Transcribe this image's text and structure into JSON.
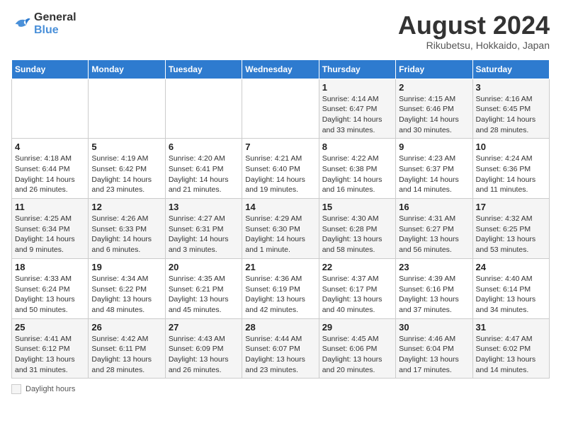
{
  "header": {
    "logo_general": "General",
    "logo_blue": "Blue",
    "month_year": "August 2024",
    "location": "Rikubetsu, Hokkaido, Japan"
  },
  "legend": {
    "label": "Daylight hours"
  },
  "weekdays": [
    "Sunday",
    "Monday",
    "Tuesday",
    "Wednesday",
    "Thursday",
    "Friday",
    "Saturday"
  ],
  "weeks": [
    [
      {
        "day": "",
        "info": ""
      },
      {
        "day": "",
        "info": ""
      },
      {
        "day": "",
        "info": ""
      },
      {
        "day": "",
        "info": ""
      },
      {
        "day": "1",
        "info": "Sunrise: 4:14 AM\nSunset: 6:47 PM\nDaylight: 14 hours\nand 33 minutes."
      },
      {
        "day": "2",
        "info": "Sunrise: 4:15 AM\nSunset: 6:46 PM\nDaylight: 14 hours\nand 30 minutes."
      },
      {
        "day": "3",
        "info": "Sunrise: 4:16 AM\nSunset: 6:45 PM\nDaylight: 14 hours\nand 28 minutes."
      }
    ],
    [
      {
        "day": "4",
        "info": "Sunrise: 4:18 AM\nSunset: 6:44 PM\nDaylight: 14 hours\nand 26 minutes."
      },
      {
        "day": "5",
        "info": "Sunrise: 4:19 AM\nSunset: 6:42 PM\nDaylight: 14 hours\nand 23 minutes."
      },
      {
        "day": "6",
        "info": "Sunrise: 4:20 AM\nSunset: 6:41 PM\nDaylight: 14 hours\nand 21 minutes."
      },
      {
        "day": "7",
        "info": "Sunrise: 4:21 AM\nSunset: 6:40 PM\nDaylight: 14 hours\nand 19 minutes."
      },
      {
        "day": "8",
        "info": "Sunrise: 4:22 AM\nSunset: 6:38 PM\nDaylight: 14 hours\nand 16 minutes."
      },
      {
        "day": "9",
        "info": "Sunrise: 4:23 AM\nSunset: 6:37 PM\nDaylight: 14 hours\nand 14 minutes."
      },
      {
        "day": "10",
        "info": "Sunrise: 4:24 AM\nSunset: 6:36 PM\nDaylight: 14 hours\nand 11 minutes."
      }
    ],
    [
      {
        "day": "11",
        "info": "Sunrise: 4:25 AM\nSunset: 6:34 PM\nDaylight: 14 hours\nand 9 minutes."
      },
      {
        "day": "12",
        "info": "Sunrise: 4:26 AM\nSunset: 6:33 PM\nDaylight: 14 hours\nand 6 minutes."
      },
      {
        "day": "13",
        "info": "Sunrise: 4:27 AM\nSunset: 6:31 PM\nDaylight: 14 hours\nand 3 minutes."
      },
      {
        "day": "14",
        "info": "Sunrise: 4:29 AM\nSunset: 6:30 PM\nDaylight: 14 hours\nand 1 minute."
      },
      {
        "day": "15",
        "info": "Sunrise: 4:30 AM\nSunset: 6:28 PM\nDaylight: 13 hours\nand 58 minutes."
      },
      {
        "day": "16",
        "info": "Sunrise: 4:31 AM\nSunset: 6:27 PM\nDaylight: 13 hours\nand 56 minutes."
      },
      {
        "day": "17",
        "info": "Sunrise: 4:32 AM\nSunset: 6:25 PM\nDaylight: 13 hours\nand 53 minutes."
      }
    ],
    [
      {
        "day": "18",
        "info": "Sunrise: 4:33 AM\nSunset: 6:24 PM\nDaylight: 13 hours\nand 50 minutes."
      },
      {
        "day": "19",
        "info": "Sunrise: 4:34 AM\nSunset: 6:22 PM\nDaylight: 13 hours\nand 48 minutes."
      },
      {
        "day": "20",
        "info": "Sunrise: 4:35 AM\nSunset: 6:21 PM\nDaylight: 13 hours\nand 45 minutes."
      },
      {
        "day": "21",
        "info": "Sunrise: 4:36 AM\nSunset: 6:19 PM\nDaylight: 13 hours\nand 42 minutes."
      },
      {
        "day": "22",
        "info": "Sunrise: 4:37 AM\nSunset: 6:17 PM\nDaylight: 13 hours\nand 40 minutes."
      },
      {
        "day": "23",
        "info": "Sunrise: 4:39 AM\nSunset: 6:16 PM\nDaylight: 13 hours\nand 37 minutes."
      },
      {
        "day": "24",
        "info": "Sunrise: 4:40 AM\nSunset: 6:14 PM\nDaylight: 13 hours\nand 34 minutes."
      }
    ],
    [
      {
        "day": "25",
        "info": "Sunrise: 4:41 AM\nSunset: 6:12 PM\nDaylight: 13 hours\nand 31 minutes."
      },
      {
        "day": "26",
        "info": "Sunrise: 4:42 AM\nSunset: 6:11 PM\nDaylight: 13 hours\nand 28 minutes."
      },
      {
        "day": "27",
        "info": "Sunrise: 4:43 AM\nSunset: 6:09 PM\nDaylight: 13 hours\nand 26 minutes."
      },
      {
        "day": "28",
        "info": "Sunrise: 4:44 AM\nSunset: 6:07 PM\nDaylight: 13 hours\nand 23 minutes."
      },
      {
        "day": "29",
        "info": "Sunrise: 4:45 AM\nSunset: 6:06 PM\nDaylight: 13 hours\nand 20 minutes."
      },
      {
        "day": "30",
        "info": "Sunrise: 4:46 AM\nSunset: 6:04 PM\nDaylight: 13 hours\nand 17 minutes."
      },
      {
        "day": "31",
        "info": "Sunrise: 4:47 AM\nSunset: 6:02 PM\nDaylight: 13 hours\nand 14 minutes."
      }
    ]
  ]
}
